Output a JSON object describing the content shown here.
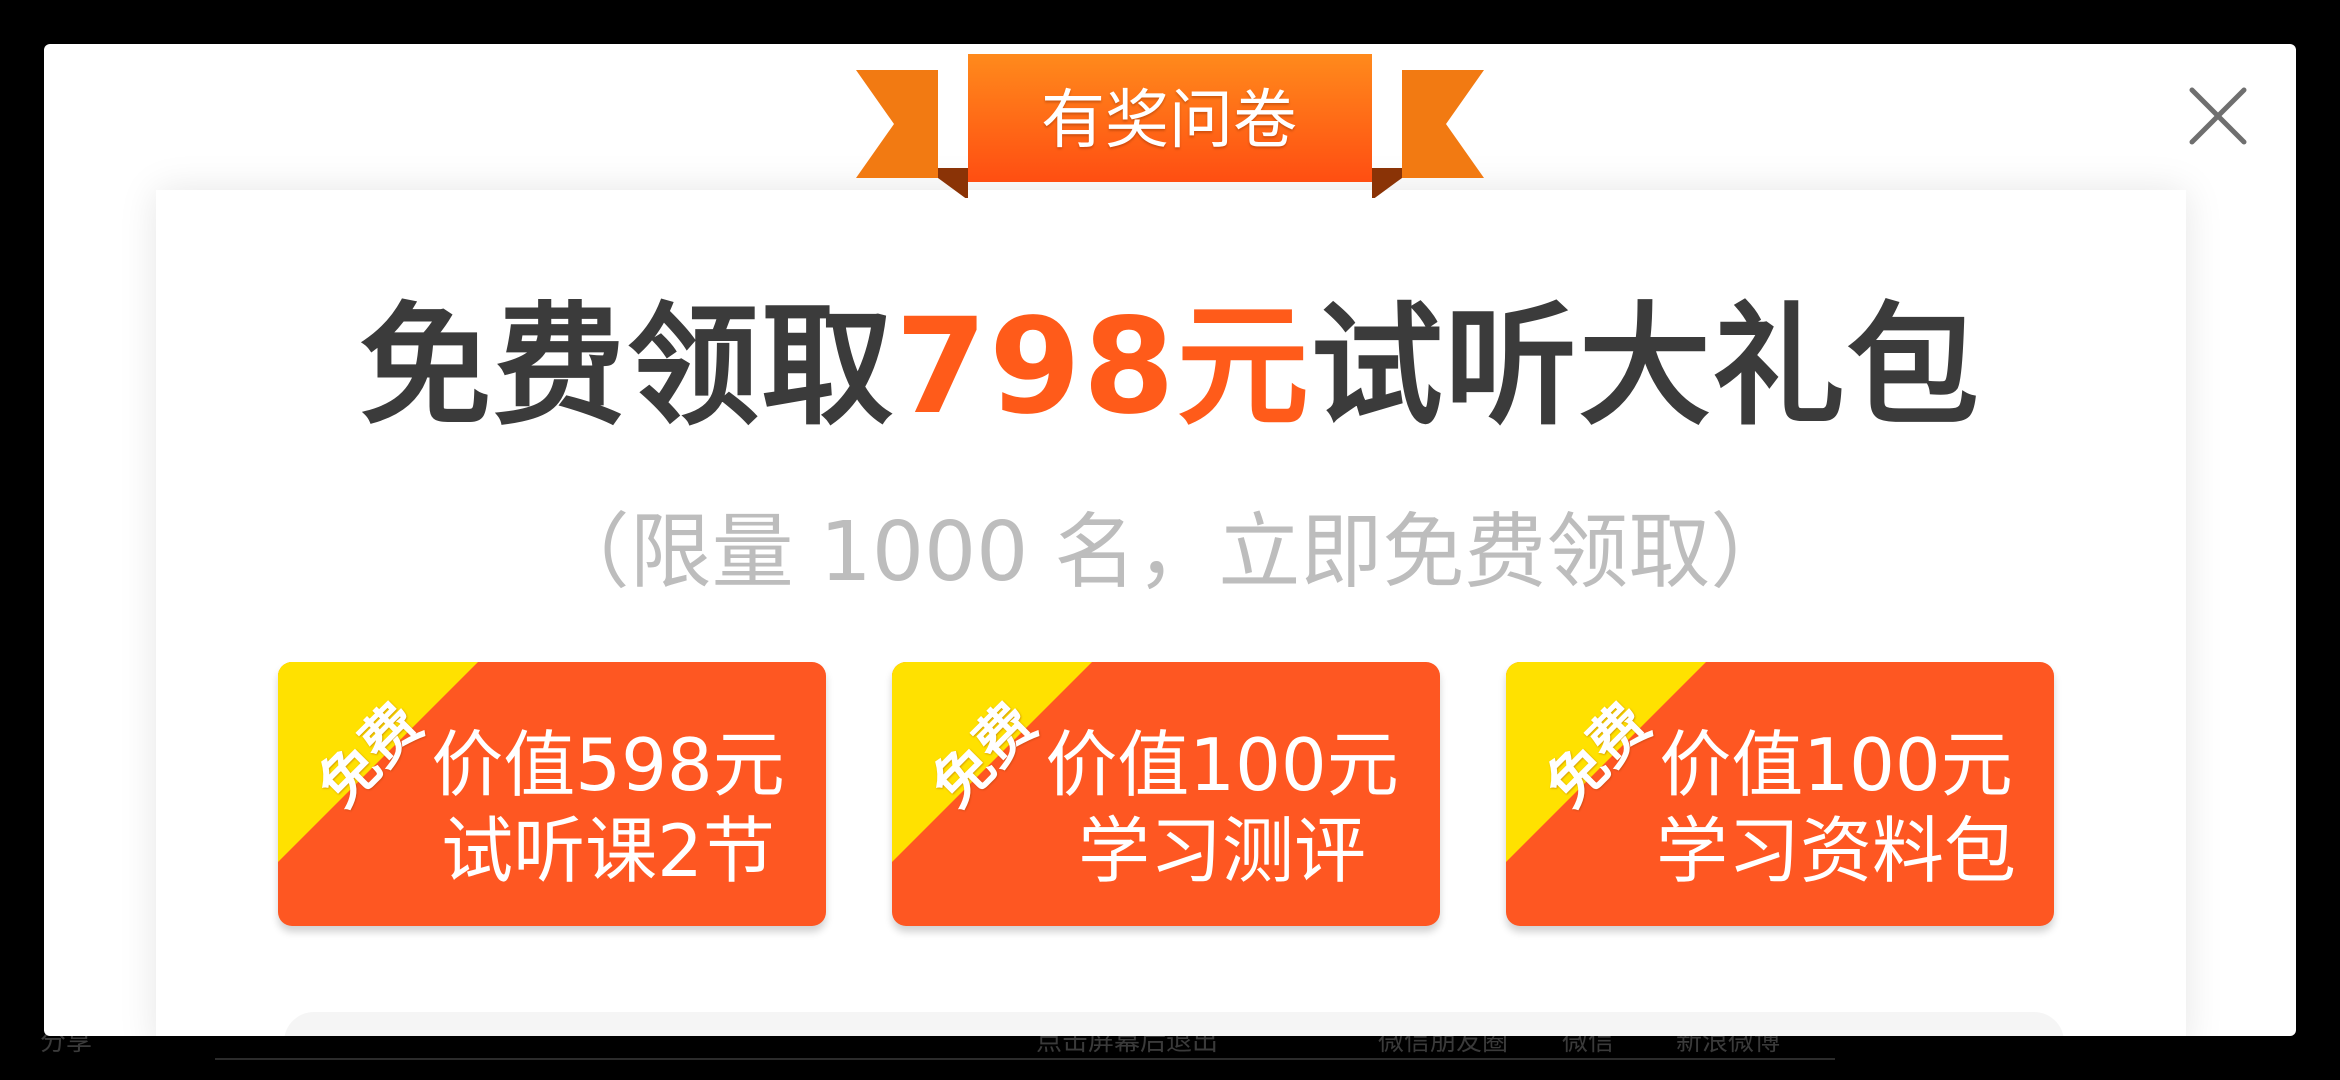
{
  "background": {
    "bottom_left_text": "分享",
    "bottom_hint_text": "点击屏幕后退出",
    "share_targets": [
      "微信朋友圈",
      "微信",
      "新浪微博"
    ]
  },
  "dialog": {
    "ribbon_title": "有奖问卷",
    "close_icon": "close-icon",
    "headline": {
      "prefix": "免费领取",
      "highlight": "798元",
      "suffix": "试听大礼包"
    },
    "subline": "（限量 1000 名，立即免费领取）",
    "cards": [
      {
        "badge": "免费",
        "line1": "价值598元",
        "line2": "试听课2节"
      },
      {
        "badge": "免费",
        "line1": "价值100元",
        "line2": "学习测评"
      },
      {
        "badge": "免费",
        "line1": "价值100元",
        "line2": "学习资料包"
      }
    ]
  },
  "colors": {
    "accent": "#ff5b1a",
    "card": "#fe5722",
    "ribbon": "#ff6a10",
    "badge": "#ffe100",
    "headline_text": "#3b3b3b",
    "subline_text": "#bdbdbd"
  }
}
